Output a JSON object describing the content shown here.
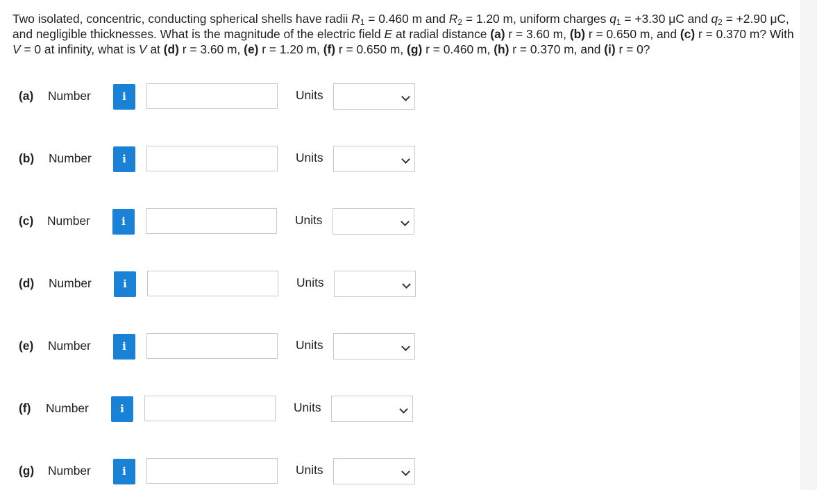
{
  "question": {
    "intro": "Two isolated, concentric, conducting spherical shells have radii ",
    "R1_sym": "R",
    "R1_sub": "1",
    "R1_val": " = 0.460 m and ",
    "R2_sym": "R",
    "R2_sub": "2",
    "R2_val": " = 1.20 m, uniform charges ",
    "q1_sym": "q",
    "q1_sub": "1",
    "q1_val": " = +3.30 μC and ",
    "q2_sym": "q",
    "q2_sub": "2",
    "q2_val": " = +2.90 μC, and negligible thicknesses. What is the magnitude of the electric field ",
    "E_sym": "E",
    "mid1": " at radial distance ",
    "a": "(a)",
    "a_val": " r = 3.60 m, ",
    "b": "(b)",
    "b_val": " r = 0.650 m, and ",
    "c": "(c)",
    "c_val": " r = 0.370 m? With ",
    "V_sym": "V",
    "mid2": " = 0 at infinity, what is ",
    "V2_sym": "V",
    "mid3": " at ",
    "d": "(d)",
    "d_val": " r = 3.60 m, ",
    "e": "(e)",
    "e_val": " r = 1.20 m, ",
    "f": "(f)",
    "f_val": " r = 0.650 m, ",
    "g": "(g)",
    "g_val": " r = 0.460 m, ",
    "h": "(h)",
    "h_val": " r = 0.370 m, and ",
    "i": "(i)",
    "i_val": " r = 0?"
  },
  "parts": [
    {
      "label": "(a)",
      "number_label": "Number",
      "info_icon": "i",
      "value": "",
      "units_label": "Units",
      "units_selected": ""
    },
    {
      "label": "(b)",
      "number_label": "Number",
      "info_icon": "i",
      "value": "",
      "units_label": "Units",
      "units_selected": ""
    },
    {
      "label": "(c)",
      "number_label": "Number",
      "info_icon": "i",
      "value": "",
      "units_label": "Units",
      "units_selected": ""
    },
    {
      "label": "(d)",
      "number_label": "Number",
      "info_icon": "i",
      "value": "",
      "units_label": "Units",
      "units_selected": ""
    },
    {
      "label": "(e)",
      "number_label": "Number",
      "info_icon": "i",
      "value": "",
      "units_label": "Units",
      "units_selected": ""
    },
    {
      "label": "(f)",
      "number_label": "Number",
      "info_icon": "i",
      "value": "",
      "units_label": "Units",
      "units_selected": ""
    },
    {
      "label": "(g)",
      "number_label": "Number",
      "info_icon": "i",
      "value": "",
      "units_label": "Units",
      "units_selected": ""
    }
  ],
  "colors": {
    "info_button": "#1a82d6",
    "input_border": "#c9c9c9",
    "text": "#1f1f1f"
  }
}
